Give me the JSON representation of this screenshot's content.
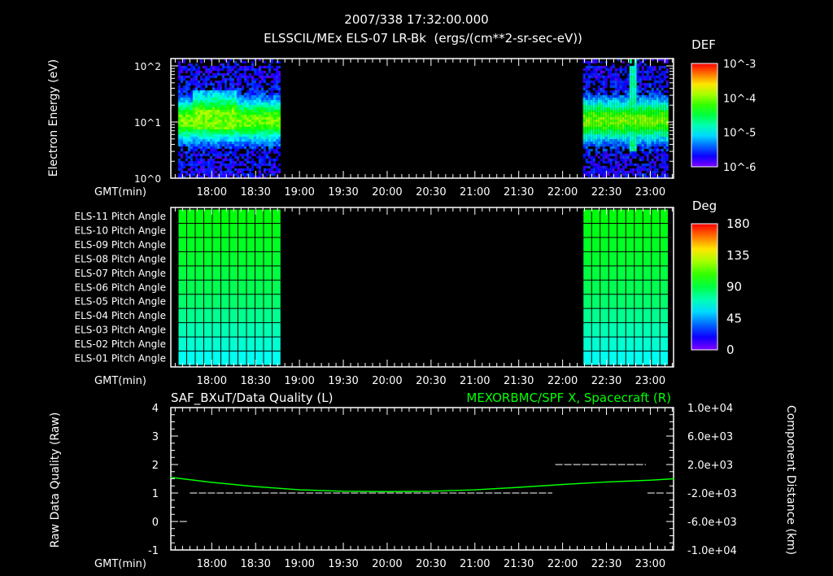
{
  "header": {
    "timestamp": "2007/338 17:32:00.000",
    "title": "ELSSCIL/MEx ELS-07 LR-Bk  (ergs/(cm**2-sr-sec-eV))"
  },
  "colors": {
    "background": "#000000",
    "axis": "#ffffff",
    "spacecraft_line": "#00ff00"
  },
  "chart_data": [
    {
      "type": "heatmap",
      "name": "electron-energy-spectrogram",
      "ylabel": "Electron Energy (eV)",
      "xlabel": "GMT(min)",
      "yscale": "log",
      "ylim": [
        1,
        135
      ],
      "ytick_labels": [
        "10^0",
        "10^1",
        "10^2"
      ],
      "x_range": [
        "17:32",
        "23:16"
      ],
      "xtick_labels": [
        "18:00",
        "18:30",
        "19:00",
        "19:30",
        "20:00",
        "20:30",
        "21:00",
        "21:30",
        "22:00",
        "22:30",
        "23:00"
      ],
      "data_intervals": [
        [
          "17:37",
          "18:47"
        ],
        [
          "22:14",
          "23:12"
        ]
      ],
      "peak_energy_band_eV": [
        5,
        30
      ],
      "colorbar": {
        "label": "DEF",
        "scale": "log",
        "range": [
          1e-06,
          0.001
        ],
        "tick_labels": [
          "10^-3",
          "10^-4",
          "10^-5",
          "10^-6"
        ]
      }
    },
    {
      "type": "heatmap",
      "name": "pitch-angle-panel",
      "xlabel": "GMT(min)",
      "rows": [
        "ELS-11 Pitch Angle",
        "ELS-10 Pitch Angle",
        "ELS-09 Pitch Angle",
        "ELS-08 Pitch Angle",
        "ELS-07 Pitch Angle",
        "ELS-06 Pitch Angle",
        "ELS-05 Pitch Angle",
        "ELS-04 Pitch Angle",
        "ELS-03 Pitch Angle",
        "ELS-02 Pitch Angle",
        "ELS-01 Pitch Angle"
      ],
      "row_values_deg": [
        98,
        96,
        94,
        92,
        89,
        86,
        82,
        76,
        70,
        65,
        60
      ],
      "data_intervals": [
        [
          "17:37",
          "18:47"
        ],
        [
          "22:14",
          "23:12"
        ]
      ],
      "xtick_labels": [
        "18:00",
        "18:30",
        "19:00",
        "19:30",
        "20:00",
        "20:30",
        "21:00",
        "21:30",
        "22:00",
        "22:30",
        "23:00"
      ],
      "colorbar": {
        "label": "Deg",
        "range": [
          0,
          180
        ],
        "tick_labels": [
          "180",
          "135",
          "90",
          "45",
          "0"
        ]
      }
    },
    {
      "type": "line",
      "name": "data-quality-and-spacecraft-position",
      "title_left": "SAF_BXuT/Data Quality (L)",
      "title_right": "MEXORBMC/SPF X, Spacecraft (R)",
      "ylabel_left": "Raw Data Quality (Raw)",
      "ylabel_right": "Component Distance (km)",
      "xlabel": "GMT(min)",
      "ylim_left": [
        -1,
        4
      ],
      "ytick_labels_left": [
        "4",
        "3",
        "2",
        "1",
        "0",
        "-1"
      ],
      "ylim_right": [
        -10000,
        10000
      ],
      "ytick_labels_right": [
        "1.0e+04",
        "6.0e+03",
        "2.0e+03",
        "-2.0e+03",
        "-6.0e+03",
        "-1.0e+04"
      ],
      "xtick_labels": [
        "18:00",
        "18:30",
        "19:00",
        "19:30",
        "20:00",
        "20:30",
        "21:00",
        "21:30",
        "22:00",
        "22:30",
        "23:00"
      ],
      "series": [
        {
          "name": "Data Quality",
          "color": "#ffffff",
          "segments": [
            {
              "start": "17:38",
              "end": "17:44",
              "value": 0
            },
            {
              "start": "17:45",
              "end": "21:53",
              "value": 1
            },
            {
              "start": "21:55",
              "end": "22:57",
              "value": 2
            },
            {
              "start": "22:58",
              "end": "23:10",
              "value": 1
            }
          ]
        },
        {
          "name": "SPF X Spacecraft",
          "color": "#00ff00",
          "x": [
            "17:32",
            "18:00",
            "18:30",
            "19:00",
            "19:30",
            "20:00",
            "20:30",
            "21:00",
            "21:30",
            "22:00",
            "22:30",
            "23:00",
            "23:16"
          ],
          "values": [
            200,
            -500,
            -1100,
            -1550,
            -1750,
            -1800,
            -1750,
            -1550,
            -1200,
            -800,
            -450,
            -200,
            0
          ]
        }
      ]
    }
  ]
}
